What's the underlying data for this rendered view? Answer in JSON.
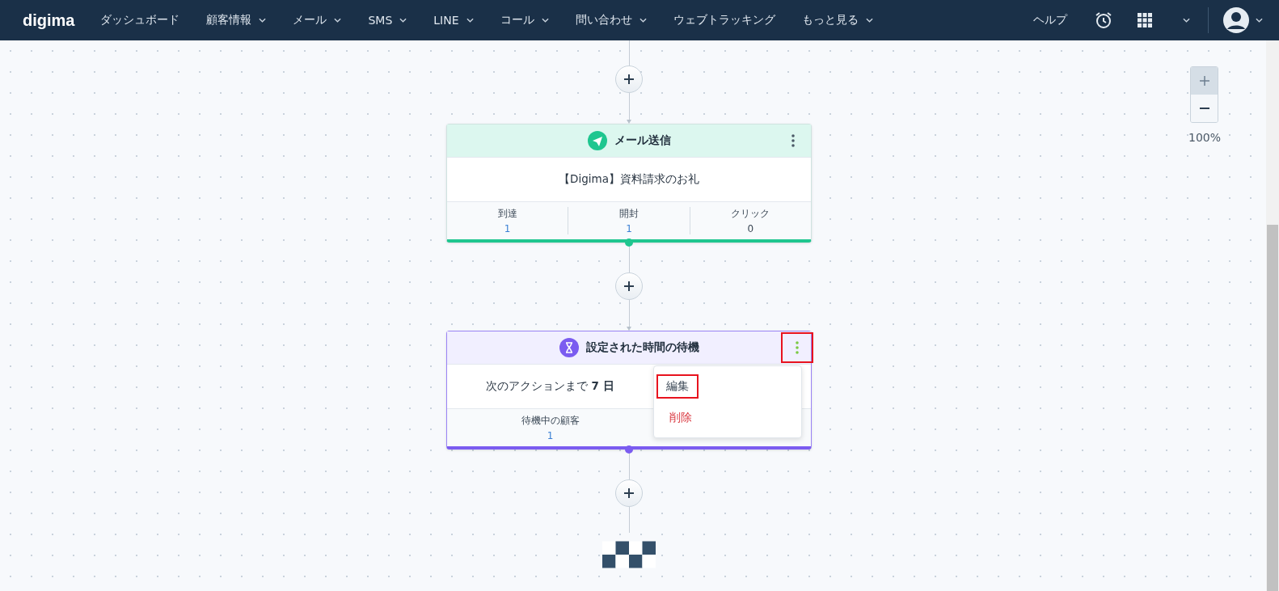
{
  "nav": {
    "logo": "digima",
    "items": [
      {
        "label": "ダッシュボード",
        "dropdown": false
      },
      {
        "label": "顧客情報",
        "dropdown": true
      },
      {
        "label": "メール",
        "dropdown": true
      },
      {
        "label": "SMS",
        "dropdown": true
      },
      {
        "label": "LINE",
        "dropdown": true
      },
      {
        "label": "コール",
        "dropdown": true
      },
      {
        "label": "問い合わせ",
        "dropdown": true
      },
      {
        "label": "ウェブトラッキング",
        "dropdown": false
      },
      {
        "label": "もっと見る",
        "dropdown": true
      }
    ],
    "help": "ヘルプ"
  },
  "zoom": {
    "level_text": "100%"
  },
  "flow": [
    {
      "kind": "mail",
      "title": "メール送信",
      "body": "【Digima】資料請求のお礼",
      "menu_highlighted": false,
      "stats": [
        {
          "label": "到達",
          "value": "1",
          "link": true
        },
        {
          "label": "開封",
          "value": "1",
          "link": true
        },
        {
          "label": "クリック",
          "value": "0",
          "link": false
        }
      ]
    },
    {
      "kind": "wait",
      "title": "設定された時間の待機",
      "body": "次のアクションまで **7 日**",
      "menu_highlighted": true,
      "stats": [
        {
          "label": "待機中の顧客",
          "value": "1",
          "link": true
        }
      ],
      "menu": [
        {
          "label": "編集",
          "kind": "edit",
          "highlighted": true
        },
        {
          "label": "削除",
          "kind": "delete",
          "highlighted": false
        }
      ]
    }
  ]
}
